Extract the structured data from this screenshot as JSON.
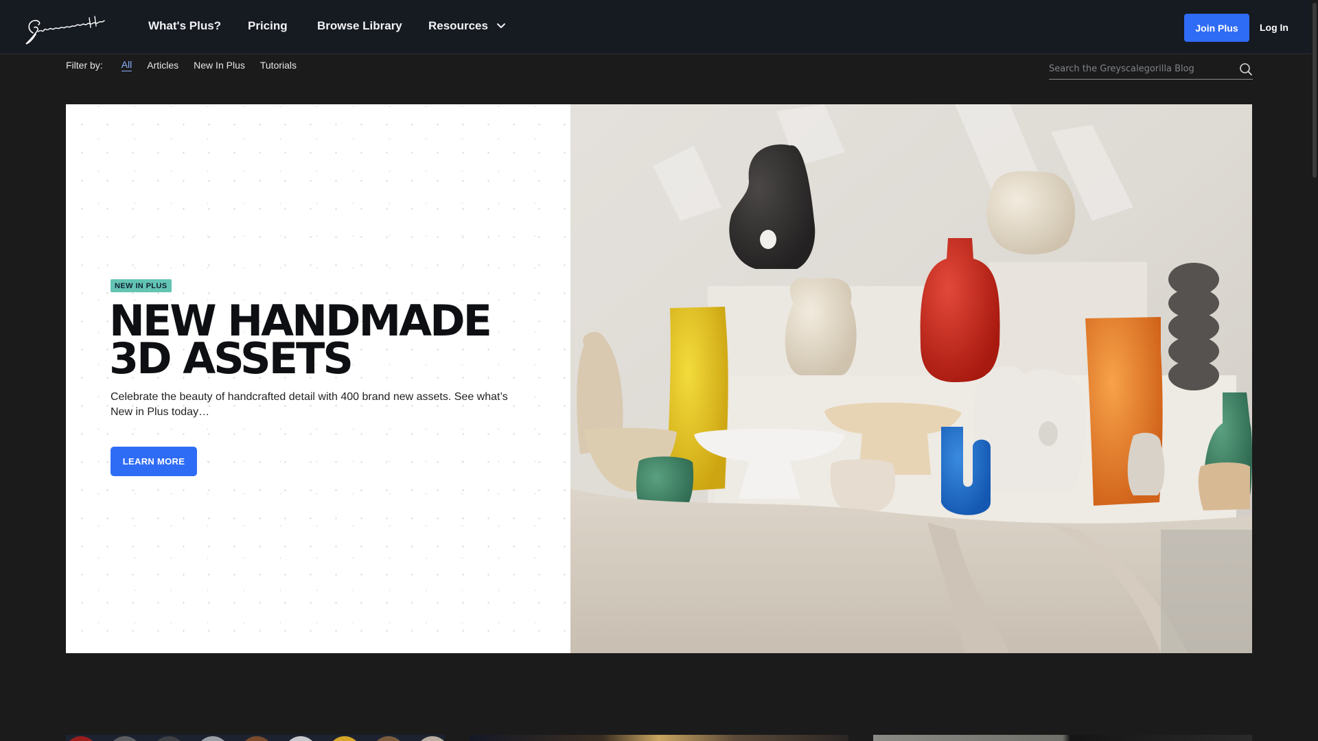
{
  "nav": {
    "logo_text": "Greyscalegorilla",
    "links": [
      "What's Plus?",
      "Pricing",
      "Browse Library",
      "Resources"
    ],
    "join_label": "Join Plus",
    "login_label": "Log In"
  },
  "filter": {
    "label": "Filter by:",
    "items": [
      "All",
      "Articles",
      "New In Plus",
      "Tutorials"
    ],
    "active": "All"
  },
  "search": {
    "placeholder": "Search the Greyscalegorilla Blog",
    "value": ""
  },
  "hero": {
    "badge": "NEW IN PLUS",
    "title": "NEW HANDMADE\n3D ASSETS",
    "description": "Celebrate the beauty of handcrafted detail with 400 brand new assets. See what’s New in Plus today…",
    "button_label": "LEARN MORE"
  },
  "colors": {
    "nav_bg": "#161a21",
    "page_bg": "#1b1b1b",
    "accent_blue": "#2f6cf5",
    "badge_teal": "#63c4b3"
  },
  "icons": [
    "greyscalegorilla-logo",
    "chevron-down-icon",
    "search-icon"
  ]
}
